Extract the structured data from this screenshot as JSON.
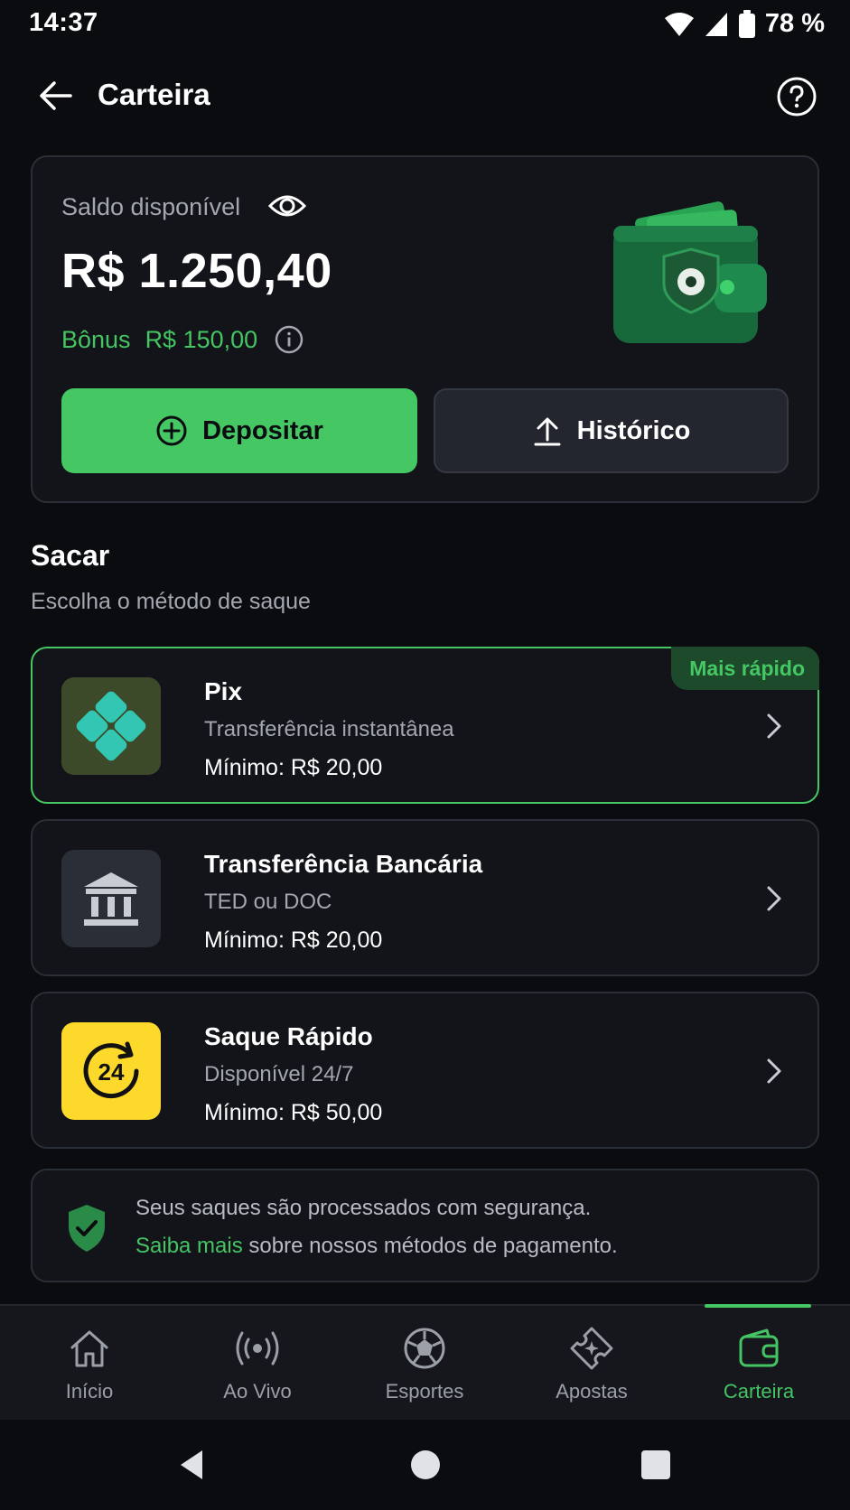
{
  "status_bar": {
    "time": "14:37",
    "battery_pct": "78 %"
  },
  "header": {
    "title": "Carteira",
    "back_icon": "arrow-left-icon",
    "help_icon": "help-circle-icon"
  },
  "balance": {
    "label": "Saldo disponível",
    "value": "R$ 1.250,40",
    "bonus_label": "Bônus",
    "bonus_value": "R$ 150,00",
    "deposit_label": "Depositar",
    "history_label": "Histórico"
  },
  "withdraw": {
    "title": "Sacar",
    "subtitle": "Escolha o método de saque",
    "methods": [
      {
        "title": "Pix",
        "subtitle": "Transferência instantânea",
        "minimum": "Mínimo: R$ 20,00",
        "badge": "Mais rápido",
        "icon": "pix-icon"
      },
      {
        "title": "Transferência Bancária",
        "subtitle": "TED ou DOC",
        "minimum": "Mínimo: R$ 20,00",
        "icon": "bank-icon"
      },
      {
        "title": "Saque Rápido",
        "subtitle": "Disponível 24/7",
        "minimum": "Mínimo: R$ 50,00",
        "icon": "24h-icon"
      }
    ]
  },
  "security": {
    "line1": "Seus saques são processados com segurança.",
    "link": "Saiba mais",
    "line2_rest": " sobre nossos métodos de pagamento."
  },
  "bottom_nav": {
    "items": [
      {
        "label": "Início",
        "icon": "home-icon"
      },
      {
        "label": "Ao Vivo",
        "icon": "live-icon"
      },
      {
        "label": "Esportes",
        "icon": "soccer-ball-icon"
      },
      {
        "label": "Apostas",
        "icon": "ticket-icon"
      },
      {
        "label": "Carteira",
        "icon": "wallet-icon",
        "active": true
      }
    ]
  },
  "colors": {
    "accent": "#45c864",
    "background": "#0a0c10",
    "card": "#121419",
    "muted_text": "#a3a8b0",
    "badge_bg": "#1c4a2b",
    "quick_icon_bg": "#fcd92a"
  }
}
